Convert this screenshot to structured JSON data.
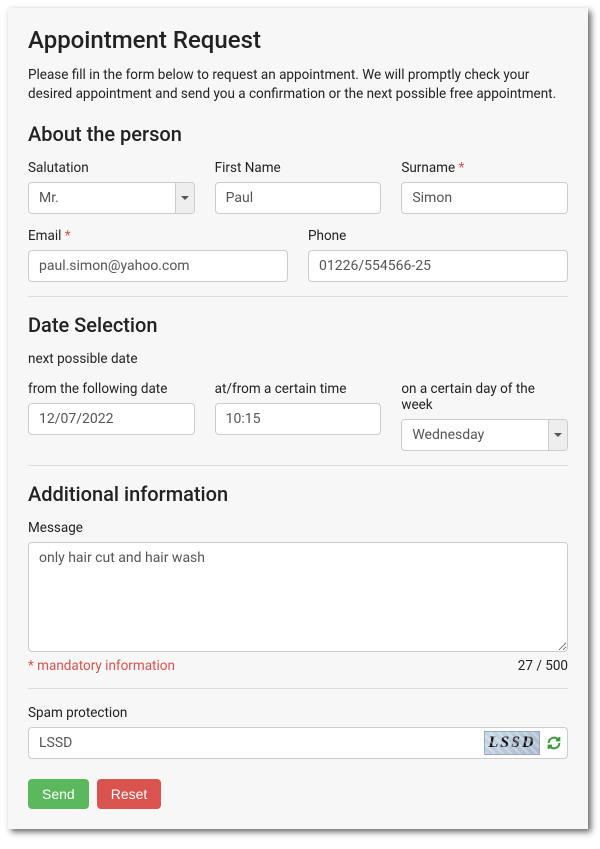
{
  "title": "Appointment Request",
  "intro": "Please fill in the form below to request an appointment. We will promptly check your desired appointment and send you a confirmation or the next possible free appointment.",
  "person": {
    "heading": "About the person",
    "salutation_label": "Salutation",
    "salutation_value": "Mr.",
    "firstname_label": "First Name",
    "firstname_value": "Paul",
    "surname_label": "Surname",
    "surname_value": "Simon",
    "email_label": "Email",
    "email_value": "paul.simon@yahoo.com",
    "phone_label": "Phone",
    "phone_value": "01226/554566-25"
  },
  "date": {
    "heading": "Date Selection",
    "subnote": "next possible date",
    "from_date_label": "from the following date",
    "from_date_value": "12/07/2022",
    "from_time_label": "at/from a certain time",
    "from_time_value": "10:15",
    "weekday_label": "on a certain day of the week",
    "weekday_value": "Wednesday"
  },
  "additional": {
    "heading": "Additional information",
    "message_label": "Message",
    "message_value": "only hair cut and hair wash",
    "mandatory_note": "* mandatory information",
    "counter": "27 / 500"
  },
  "spam": {
    "label": "Spam protection",
    "value": "LSSD",
    "captcha_text": "LSSD"
  },
  "buttons": {
    "send": "Send",
    "reset": "Reset"
  },
  "required_marker": "*"
}
